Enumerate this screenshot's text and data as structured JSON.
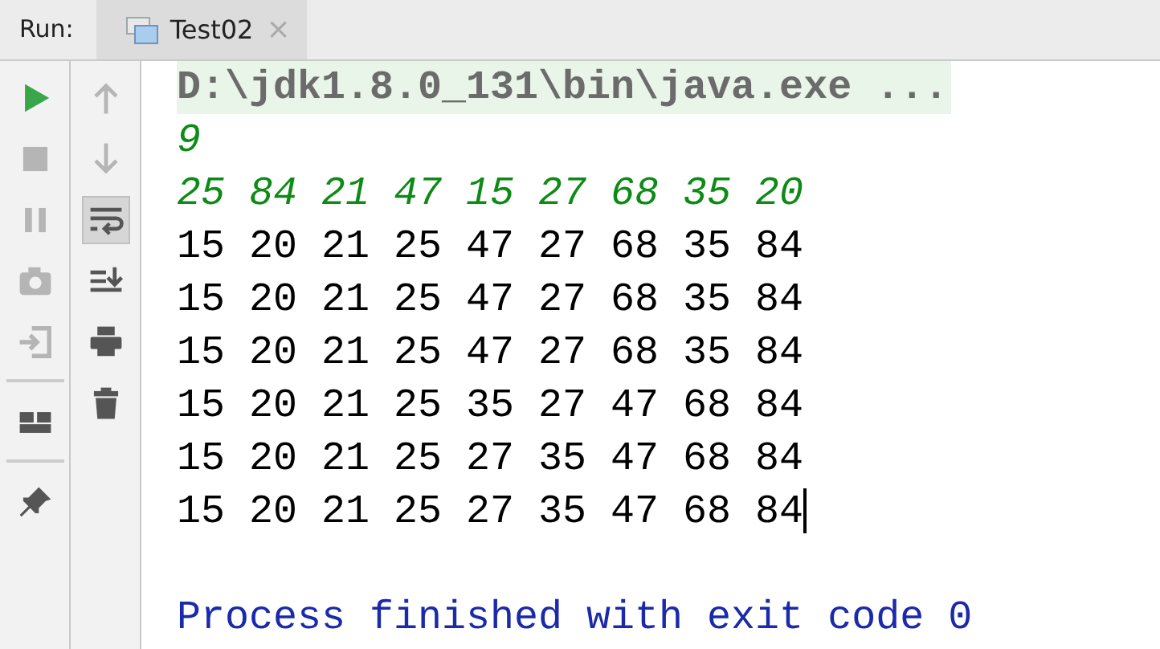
{
  "run_bar": {
    "label": "Run:",
    "tabs": [
      {
        "title": "Test02",
        "selected": true,
        "close": "×"
      }
    ]
  },
  "left_toolbar": [
    {
      "kind": "run",
      "disabled": false
    },
    {
      "kind": "stop",
      "disabled": true
    },
    {
      "kind": "pause",
      "disabled": true
    },
    {
      "kind": "camera",
      "disabled": true
    },
    {
      "kind": "exit",
      "disabled": true
    },
    {
      "kind": "divider"
    },
    {
      "kind": "layout",
      "disabled": false
    },
    {
      "kind": "divider"
    },
    {
      "kind": "pin",
      "disabled": false
    }
  ],
  "right_toolbar": [
    {
      "kind": "up",
      "disabled": true
    },
    {
      "kind": "down",
      "disabled": true
    },
    {
      "kind": "wrap",
      "on": true
    },
    {
      "kind": "scroll-end",
      "on": false
    },
    {
      "kind": "print",
      "disabled": false
    },
    {
      "kind": "trash",
      "disabled": false
    }
  ],
  "console_lines": [
    {
      "kind": "command",
      "text": "D:\\jdk1.8.0_131\\bin\\java.exe ..."
    },
    {
      "kind": "input",
      "text": "9"
    },
    {
      "kind": "input",
      "text": "25 84 21 47 15 27 68 35 20"
    },
    {
      "kind": "output",
      "text": "15 20 21 25 47 27 68 35 84"
    },
    {
      "kind": "output",
      "text": "15 20 21 25 47 27 68 35 84"
    },
    {
      "kind": "output",
      "text": "15 20 21 25 47 27 68 35 84"
    },
    {
      "kind": "output",
      "text": "15 20 21 25 35 27 47 68 84"
    },
    {
      "kind": "output",
      "text": "15 20 21 25 27 35 47 68 84"
    },
    {
      "kind": "output",
      "text": "15 20 21 25 27 35 47 68 84",
      "cursor": true
    },
    {
      "kind": "blank"
    },
    {
      "kind": "system",
      "text": "Process finished with exit code 0"
    }
  ]
}
